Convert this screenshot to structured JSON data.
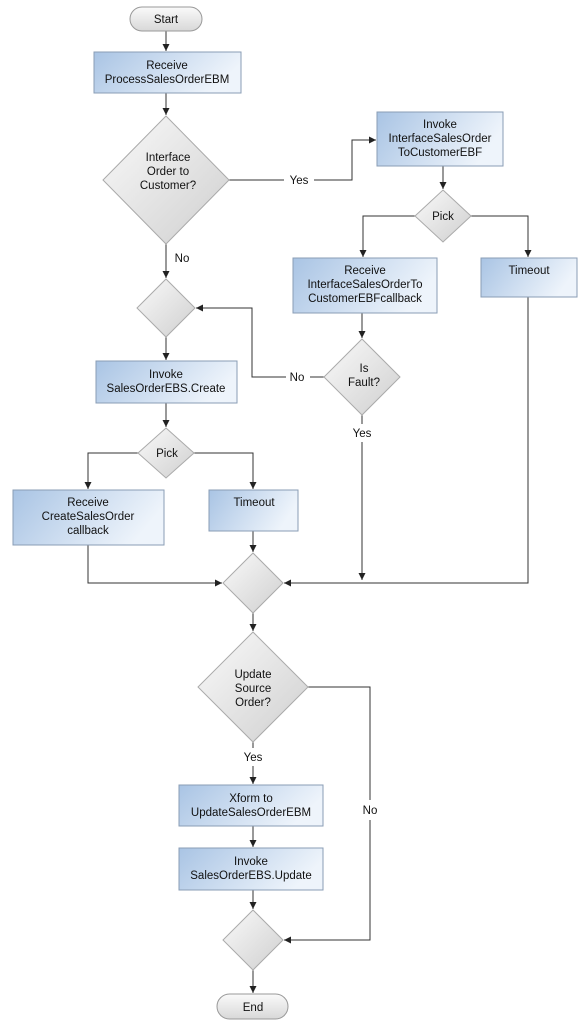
{
  "nodes": {
    "start": {
      "label": "Start"
    },
    "receive_process": {
      "lines": [
        "Receive",
        "ProcessSalesOrderEBM"
      ]
    },
    "decision_interface": {
      "lines": [
        "Interface",
        "Order to",
        "Customer?"
      ]
    },
    "invoke_interface": {
      "lines": [
        "Invoke",
        "InterfaceSalesOrder",
        "ToCustomerEBF"
      ]
    },
    "pick_right": {
      "label": "Pick"
    },
    "receive_interface_callback": {
      "lines": [
        "Receive",
        "InterfaceSalesOrderTo",
        "CustomerEBFcallback"
      ]
    },
    "timeout_right": {
      "label": "Timeout"
    },
    "decision_fault": {
      "lines": [
        "Is",
        "Fault?"
      ]
    },
    "invoke_create": {
      "lines": [
        "Invoke",
        "SalesOrderEBS.Create"
      ]
    },
    "pick_left": {
      "label": "Pick"
    },
    "receive_create_callback": {
      "lines": [
        "Receive",
        "CreateSalesOrder",
        "callback"
      ]
    },
    "timeout_left": {
      "label": "Timeout"
    },
    "decision_update": {
      "lines": [
        "Update",
        "Source",
        "Order?"
      ]
    },
    "xform_update": {
      "lines": [
        "Xform to",
        "UpdateSalesOrderEBM"
      ]
    },
    "invoke_update": {
      "lines": [
        "Invoke",
        "SalesOrderEBS.Update"
      ]
    },
    "end": {
      "label": "End"
    }
  },
  "edge_labels": {
    "interface_yes": "Yes",
    "interface_no": "No",
    "fault_no": "No",
    "fault_yes": "Yes",
    "update_yes": "Yes",
    "update_no": "No"
  },
  "colors": {
    "box_fill_dark": "#a9c4e4",
    "box_fill_light": "#eef4fb",
    "diamond_fill": "#e2e2e2",
    "line": "#333333"
  }
}
